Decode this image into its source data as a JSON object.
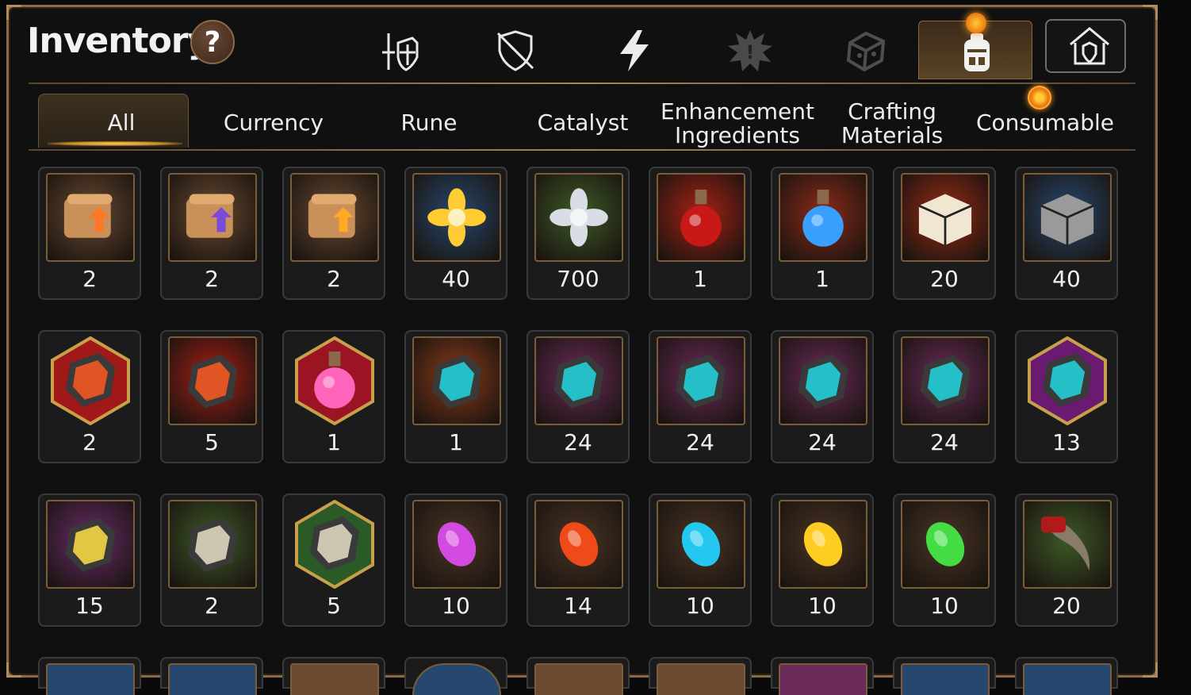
{
  "header": {
    "title": "Inventory",
    "help_label": "?",
    "category_icons": [
      {
        "name": "weapon-armor-icon"
      },
      {
        "name": "artifact-shield-icon"
      },
      {
        "name": "lightning-icon"
      },
      {
        "name": "burst-badge-icon"
      },
      {
        "name": "die-icon"
      },
      {
        "name": "backpack-icon"
      }
    ],
    "storage_icon": "house-shield-icon"
  },
  "tabs": [
    {
      "label": "All",
      "selected": true
    },
    {
      "label": "Currency"
    },
    {
      "label": "Rune"
    },
    {
      "label": "Catalyst"
    },
    {
      "label": "Enhancement\nIngredients"
    },
    {
      "label": "Crafting\nMaterials"
    },
    {
      "label": "Consumable",
      "notification": true
    }
  ],
  "items": [
    {
      "icon": "scroll-fire-arrow-icon",
      "count": "2",
      "bg": "#6a4a30"
    },
    {
      "icon": "scroll-rainbow-cube-icon",
      "count": "2",
      "bg": "#6a4a30"
    },
    {
      "icon": "scroll-gold-arrow-icon",
      "count": "2",
      "bg": "#6a4a30"
    },
    {
      "icon": "gold-flower-crystal-icon",
      "count": "40",
      "bg": "#27486e"
    },
    {
      "icon": "silver-flower-crystal-icon",
      "count": "700",
      "bg": "#3d5a26"
    },
    {
      "icon": "red-potion-icon",
      "count": "1",
      "bg": "#a82214"
    },
    {
      "icon": "star-potion-icon",
      "count": "1",
      "bg": "#8c2a18"
    },
    {
      "icon": "gold-chest-icon",
      "count": "20",
      "bg": "#9a2a14"
    },
    {
      "icon": "silver-chest-icon",
      "count": "40",
      "bg": "#27486e"
    },
    {
      "icon": "red-star-stone-icon",
      "count": "2",
      "bg": "#a01818",
      "hex": true
    },
    {
      "icon": "red-hammer-stone-icon",
      "count": "5",
      "bg": "#a81e14"
    },
    {
      "icon": "pink-potion-icon",
      "count": "1",
      "bg": "#9a1424",
      "hex": true
    },
    {
      "icon": "blue-hammer-stone-icon",
      "count": "1",
      "bg": "#8a3a18"
    },
    {
      "icon": "sword-stone-icon",
      "count": "24",
      "bg": "#6a2a5a"
    },
    {
      "icon": "helmet-stone-icon",
      "count": "24",
      "bg": "#6a2a5a"
    },
    {
      "icon": "armor-stone-icon",
      "count": "24",
      "bg": "#6a2a5a"
    },
    {
      "icon": "boot-stone-icon",
      "count": "24",
      "bg": "#6a2a5a"
    },
    {
      "icon": "purple-star-stone-icon",
      "count": "13",
      "bg": "#6a1a70",
      "hex": true
    },
    {
      "icon": "yellow-hammer-stone-icon",
      "count": "15",
      "bg": "#6a2a6a"
    },
    {
      "icon": "white-sword-stone-icon",
      "count": "2",
      "bg": "#3d5a26"
    },
    {
      "icon": "white-star-stone-icon",
      "count": "5",
      "bg": "#2a5a26",
      "hex": true
    },
    {
      "icon": "purple-gem-icon",
      "count": "10",
      "bg": "#4a3424"
    },
    {
      "icon": "red-gem-icon",
      "count": "14",
      "bg": "#4a3424"
    },
    {
      "icon": "blue-gem-icon",
      "count": "10",
      "bg": "#4a3424"
    },
    {
      "icon": "yellow-gem-icon",
      "count": "10",
      "bg": "#4a3424"
    },
    {
      "icon": "green-gem-icon",
      "count": "10",
      "bg": "#4a3424"
    },
    {
      "icon": "claw-icon",
      "count": "20",
      "bg": "#3d5a26"
    }
  ],
  "colors": {
    "accent": "#c78a2a",
    "frame": "#8a6a44",
    "notification": "#ee7711"
  }
}
